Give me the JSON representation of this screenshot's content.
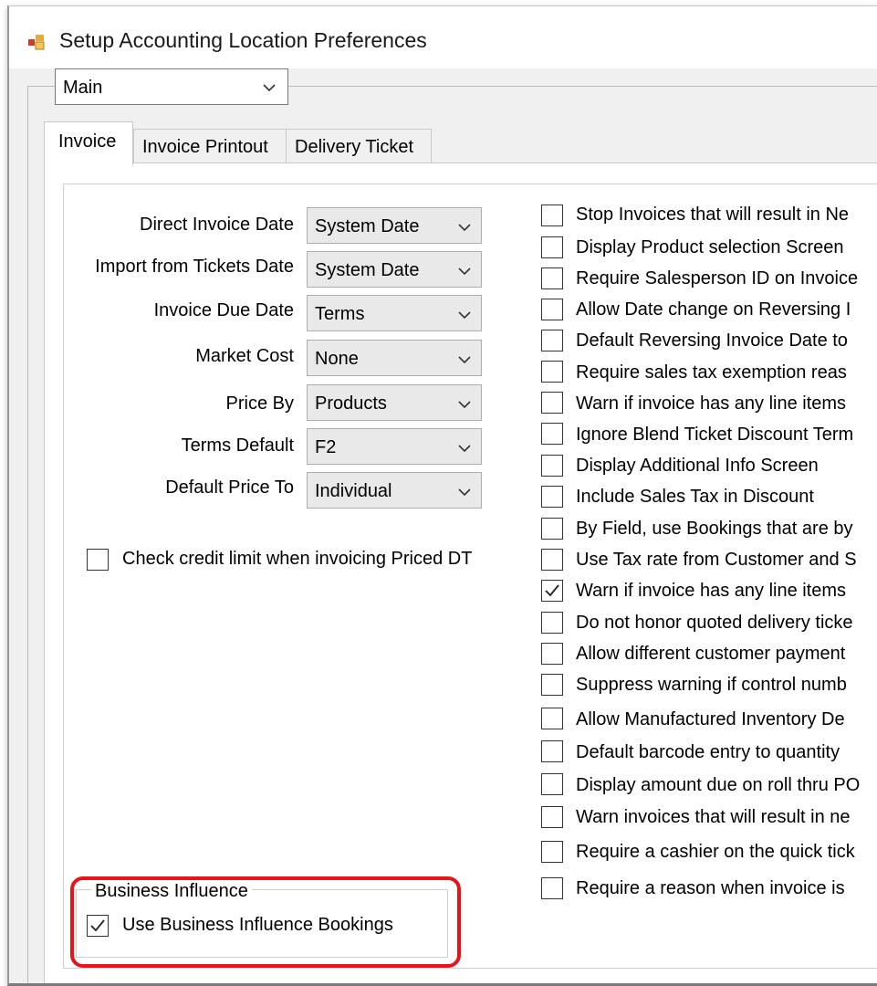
{
  "window": {
    "title": "Setup Accounting Location Preferences",
    "icon": "app-window-icon"
  },
  "view_selector": {
    "value": "Main"
  },
  "tabs": [
    {
      "label": "Invoice",
      "active": true
    },
    {
      "label": "Invoice Printout",
      "active": false
    },
    {
      "label": "Delivery Ticket",
      "active": false
    }
  ],
  "fields": [
    {
      "label": "Direct Invoice Date",
      "value": "System Date"
    },
    {
      "label": "Import from Tickets Date",
      "value": "System Date"
    },
    {
      "label": "Invoice Due Date",
      "value": "Terms"
    },
    {
      "label": "Market Cost",
      "value": "None"
    },
    {
      "label": "Price By",
      "value": "Products"
    },
    {
      "label": "Terms Default",
      "value": "F2"
    },
    {
      "label": "Default Price To",
      "value": "Individual"
    }
  ],
  "credit_limit_checkbox": {
    "label": "Check credit limit when invoicing Priced DT",
    "checked": false
  },
  "options": [
    {
      "label": "Stop Invoices that will result in Ne",
      "checked": false
    },
    {
      "label": "Display Product selection Screen",
      "checked": false
    },
    {
      "label": "Require Salesperson ID on Invoice",
      "checked": false
    },
    {
      "label": "Allow Date change on Reversing I",
      "checked": false
    },
    {
      "label": "Default Reversing Invoice Date to",
      "checked": false
    },
    {
      "label": "Require sales tax exemption reas",
      "checked": false
    },
    {
      "label": "Warn if invoice has any line items",
      "checked": false
    },
    {
      "label": "Ignore Blend Ticket Discount Term",
      "checked": false
    },
    {
      "label": "Display Additional Info Screen",
      "checked": false
    },
    {
      "label": "Include Sales Tax in Discount",
      "checked": false
    },
    {
      "label": "By Field, use Bookings that are by",
      "checked": false
    },
    {
      "label": "Use Tax rate from Customer and S",
      "checked": false
    },
    {
      "label": "Warn if invoice has any line items",
      "checked": true
    },
    {
      "label": "Do not honor quoted delivery ticke",
      "checked": false
    },
    {
      "label": "Allow different customer payment",
      "checked": false
    },
    {
      "label": "Suppress warning if control numb",
      "checked": false
    },
    {
      "label": "Allow Manufactured Inventory De",
      "checked": false
    },
    {
      "label": "Default barcode entry to quantity",
      "checked": false
    },
    {
      "label": "Display amount due on roll thru PO",
      "checked": false
    },
    {
      "label": "Warn invoices that will result in ne",
      "checked": false
    },
    {
      "label": "Require a cashier on the quick tick",
      "checked": false
    },
    {
      "label": "Require a reason when invoice is",
      "checked": false
    }
  ],
  "business_influence": {
    "title": "Business Influence",
    "checkbox_label": "Use Business Influence Bookings",
    "checked": true
  },
  "colors": {
    "highlight": "#e8141a",
    "window_bg": "#f0f0f0",
    "panel_bg": "#ffffff"
  }
}
